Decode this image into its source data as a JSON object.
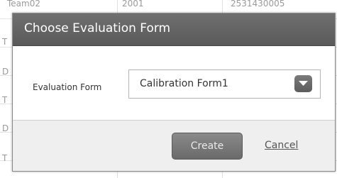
{
  "background_table": {
    "rows": [
      {
        "c1": "Team02",
        "c2": "2001",
        "c3": "2531430005"
      },
      {
        "c1": "T",
        "c2": "",
        "c3": ""
      },
      {
        "c1": "D",
        "c2": "",
        "c3": ""
      },
      {
        "c1": "T",
        "c2": "",
        "c3": ""
      },
      {
        "c1": "D",
        "c2": "",
        "c3": ""
      },
      {
        "c1": "T",
        "c2": "",
        "c3": ""
      }
    ]
  },
  "dialog": {
    "title": "Choose Evaluation Form",
    "field_label": "Evaluation Form",
    "select_value": "Calibration Form1",
    "create_label": "Create",
    "cancel_label": "Cancel"
  }
}
